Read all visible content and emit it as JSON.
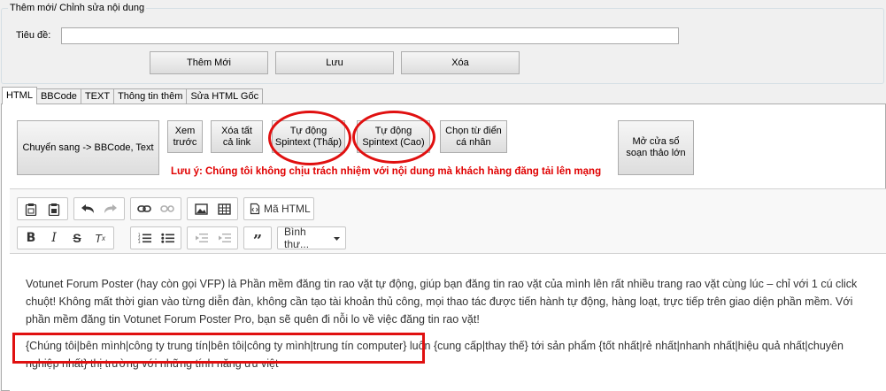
{
  "groupbox": {
    "title": "Thêm mới/ Chỉnh sửa nội dung",
    "title_label": "Tiêu đề:",
    "title_value": "",
    "add_label": "Thêm Mới",
    "save_label": "Lưu",
    "delete_label": "Xóa"
  },
  "tabs": [
    "HTML",
    "BBCode",
    "TEXT",
    "Thông tin thêm",
    "Sửa HTML Gốc"
  ],
  "tools": {
    "convert": "Chuyển sang -> BBCode, Text",
    "preview_1": "Xem",
    "preview_2": "trước",
    "remove_links_1": "Xóa tất",
    "remove_links_2": "cả link",
    "spin_low_1": "Tự động",
    "spin_low_2": "Spintext (Thấp)",
    "spin_high_1": "Tự động",
    "spin_high_2": "Spintext (Cao)",
    "dict_1": "Chọn từ điển",
    "dict_2": "cá nhân",
    "big_editor_1": "Mở cửa sổ",
    "big_editor_2": "soạn thảo lớn",
    "warning": "Lưu ý: Chúng tôi không chịu trách nhiệm với nội dung mà khách hàng đăng tải lên mạng"
  },
  "editor_toolbar": {
    "source_label": "Mã HTML",
    "format_label": "Bình thư...",
    "icons": [
      "paste-icon",
      "paste-text-icon",
      "undo-icon",
      "redo-icon",
      "link-icon",
      "unlink-icon",
      "image-icon",
      "table-icon",
      "source-icon",
      "bold-icon",
      "italic-icon",
      "strikethrough-icon",
      "remove-format-icon",
      "numbered-list-icon",
      "bulleted-list-icon",
      "outdent-icon",
      "indent-icon",
      "blockquote-icon",
      "dropdown-arrow-icon"
    ]
  },
  "content": {
    "paragraph1": "Votunet Forum Poster (hay còn gọi VFP) là Phần mềm đăng tin rao vặt tự động, giúp bạn đăng tin rao vặt của mình lên rất nhiều trang rao vặt cùng lúc – chỉ với 1 cú click chuột! Không mất thời gian vào từng diễn đàn, không cần tạo tài khoản thủ công, mọi thao tác được tiến hành tự động, hàng loạt, trực tiếp trên giao diện phần mềm. Với phần mềm đăng tin Votunet Forum Poster Pro, bạn sẽ quên đi nỗi lo về việc đăng tin rao vặt!",
    "paragraph2": "{Chúng tôi|bên mình|công ty trung tín|bên tôi|công ty mình|trung tín computer} luôn {cung cấp|thay thế} tới sản phẩm {tốt nhất|rẻ nhất|nhanh nhất|hiệu quả nhất|chuyên nghiệp nhất} thị trường với những tính năng ưu việt"
  },
  "colors": {
    "annotation": "#e01010",
    "warning": "#e00000"
  }
}
